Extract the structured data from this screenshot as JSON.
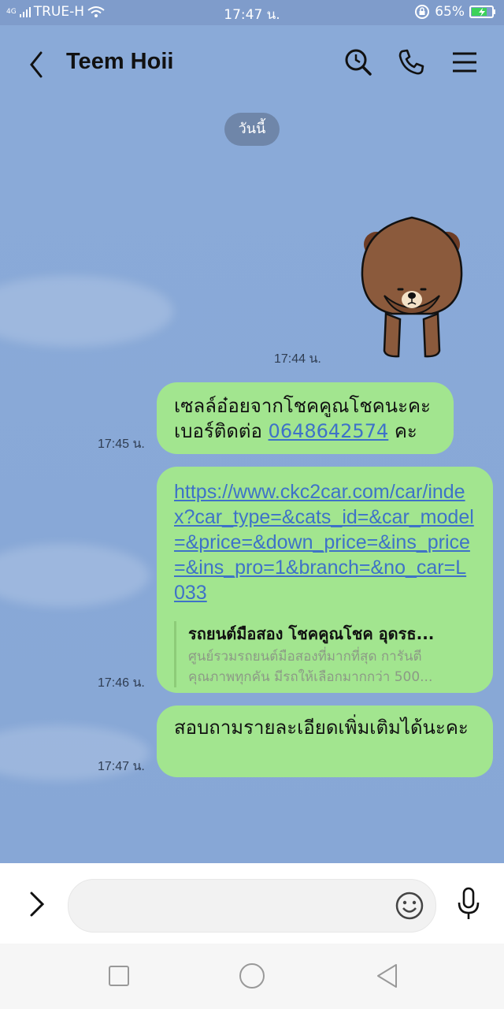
{
  "status_bar": {
    "network": "4G",
    "carrier": "TRUE-H",
    "time": "17:47 น.",
    "battery": "65%"
  },
  "header": {
    "contact_name": "Teem Hoii",
    "icons": [
      "back-arrow-icon",
      "search-history-icon",
      "phone-icon",
      "menu-icon"
    ]
  },
  "chat": {
    "date_label": "วันนี้",
    "messages": [
      {
        "type": "sticker",
        "sticker": "brown-bear-bowing",
        "time": "17:44 น."
      },
      {
        "type": "text",
        "line1": "เซลล์อ๋อยจากโชคคูณโชคนะคะ",
        "line2_prefix": "เบอร์ติดต่อ ",
        "phone": "0648642574",
        "line2_suffix": " คะ",
        "time": "17:45 น."
      },
      {
        "type": "link",
        "url": "https://www.ckc2car.com/car/index?car_type=&cats_id=&car_model=&price=&down_price=&ins_price=&ins_pro=1&branch=&no_car=L033",
        "preview_title": "รถยนต์มือสอง โชคคูณโชค อุดรธ...",
        "preview_desc_1": "ศูนย์รวมรถยนต์มือสองที่มากที่สุด การันตี",
        "preview_desc_2": "คุณภาพทุกคัน มีรถให้เลือกมากกว่า 500...",
        "time": "17:46 น."
      },
      {
        "type": "text",
        "text": "สอบถามรายละเอียดเพิ่มเติมได้นะคะ",
        "time": "17:47 น."
      }
    ]
  },
  "input_bar": {
    "placeholder": ""
  },
  "colors": {
    "chat_bg": "#8aaad8",
    "bubble": "#a2e58f",
    "link": "#3e72c8"
  }
}
